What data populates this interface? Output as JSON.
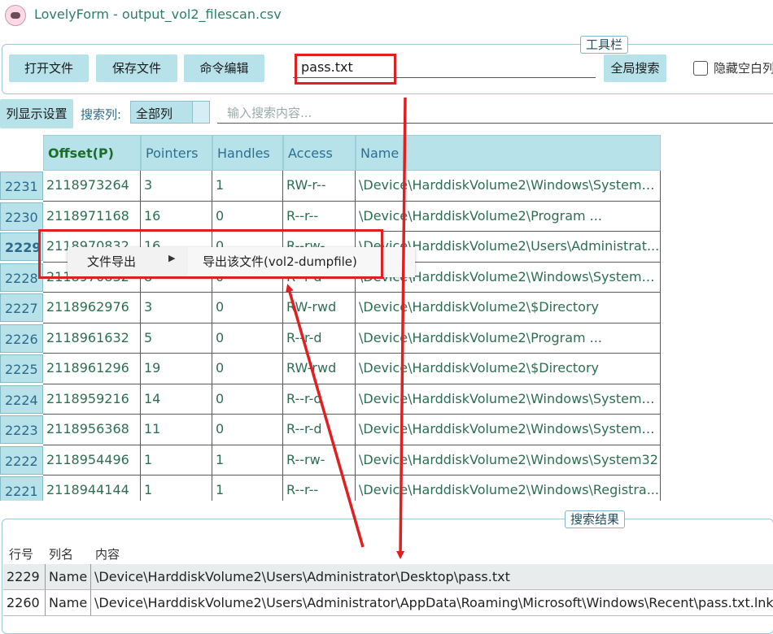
{
  "window": {
    "title": "LovelyForm - output_vol2_filescan.csv"
  },
  "toolbar": {
    "group_title": "工具栏",
    "open_file": "打开文件",
    "save_file": "保存文件",
    "cmd_edit": "命令编辑",
    "search_value": "pass.txt",
    "global_search": "全局搜索",
    "hide_empty_label": "隐藏空白列"
  },
  "filter_bar": {
    "column_display": "列显示设置",
    "search_col_label": "搜索列:",
    "search_col_value": "全部列",
    "search_placeholder": "输入搜索内容..."
  },
  "grid": {
    "columns": [
      "Offset(P)",
      "Pointers",
      "Handles",
      "Access",
      "Name"
    ],
    "rows": [
      {
        "idx": "2231",
        "offset": "2118973264",
        "pointers": "3",
        "handles": "1",
        "access": "RW-r--",
        "name": "\\Device\\HarddiskVolume2\\Windows\\System3..."
      },
      {
        "idx": "2230",
        "offset": "2118971168",
        "pointers": "16",
        "handles": "0",
        "access": "R--r--",
        "name": "\\Device\\HarddiskVolume2\\Program ..."
      },
      {
        "idx": "2229",
        "offset": "2118970832",
        "pointers": "16",
        "handles": "0",
        "access": "R--rw-",
        "name": "\\Device\\HarddiskVolume2\\Users\\Administrat..."
      },
      {
        "idx": "2228",
        "offset": "2118970832",
        "pointers": "8",
        "handles": "0",
        "access": "R--r-d",
        "name": "\\Device\\HarddiskVolume2\\Windows\\System3..."
      },
      {
        "idx": "2227",
        "offset": "2118962976",
        "pointers": "3",
        "handles": "0",
        "access": "RW-rwd",
        "name": "\\Device\\HarddiskVolume2\\$Directory"
      },
      {
        "idx": "2226",
        "offset": "2118961632",
        "pointers": "5",
        "handles": "0",
        "access": "R--r-d",
        "name": "\\Device\\HarddiskVolume2\\Program ..."
      },
      {
        "idx": "2225",
        "offset": "2118961296",
        "pointers": "19",
        "handles": "0",
        "access": "RW-rwd",
        "name": "\\Device\\HarddiskVolume2\\$Directory"
      },
      {
        "idx": "2224",
        "offset": "2118959216",
        "pointers": "14",
        "handles": "0",
        "access": "R--r-d",
        "name": "\\Device\\HarddiskVolume2\\Windows\\System3..."
      },
      {
        "idx": "2223",
        "offset": "2118956368",
        "pointers": "11",
        "handles": "0",
        "access": "R--r-d",
        "name": "\\Device\\HarddiskVolume2\\Windows\\System3..."
      },
      {
        "idx": "2222",
        "offset": "2118954496",
        "pointers": "1",
        "handles": "1",
        "access": "R--rw-",
        "name": "\\Device\\HarddiskVolume2\\Windows\\System32"
      },
      {
        "idx": "2221",
        "offset": "2118944144",
        "pointers": "1",
        "handles": "1",
        "access": "R--r--",
        "name": "\\Device\\HarddiskVolume2\\Windows\\Registra..."
      }
    ]
  },
  "context_menu": {
    "item": "文件导出",
    "submenu_item": "导出该文件(vol2-dumpfile)"
  },
  "results": {
    "group_title": "搜索结果",
    "headers": [
      "行号",
      "列名",
      "内容"
    ],
    "rows": [
      {
        "line": "2229",
        "col": "Name",
        "content": "\\Device\\HarddiskVolume2\\Users\\Administrator\\Desktop\\pass.txt"
      },
      {
        "line": "2260",
        "col": "Name",
        "content": "\\Device\\HarddiskVolume2\\Users\\Administrator\\AppData\\Roaming\\Microsoft\\Windows\\Recent\\pass.txt.lnk"
      }
    ]
  },
  "annotation_color": "#e02020",
  "accent_color": "#b7e2ea"
}
